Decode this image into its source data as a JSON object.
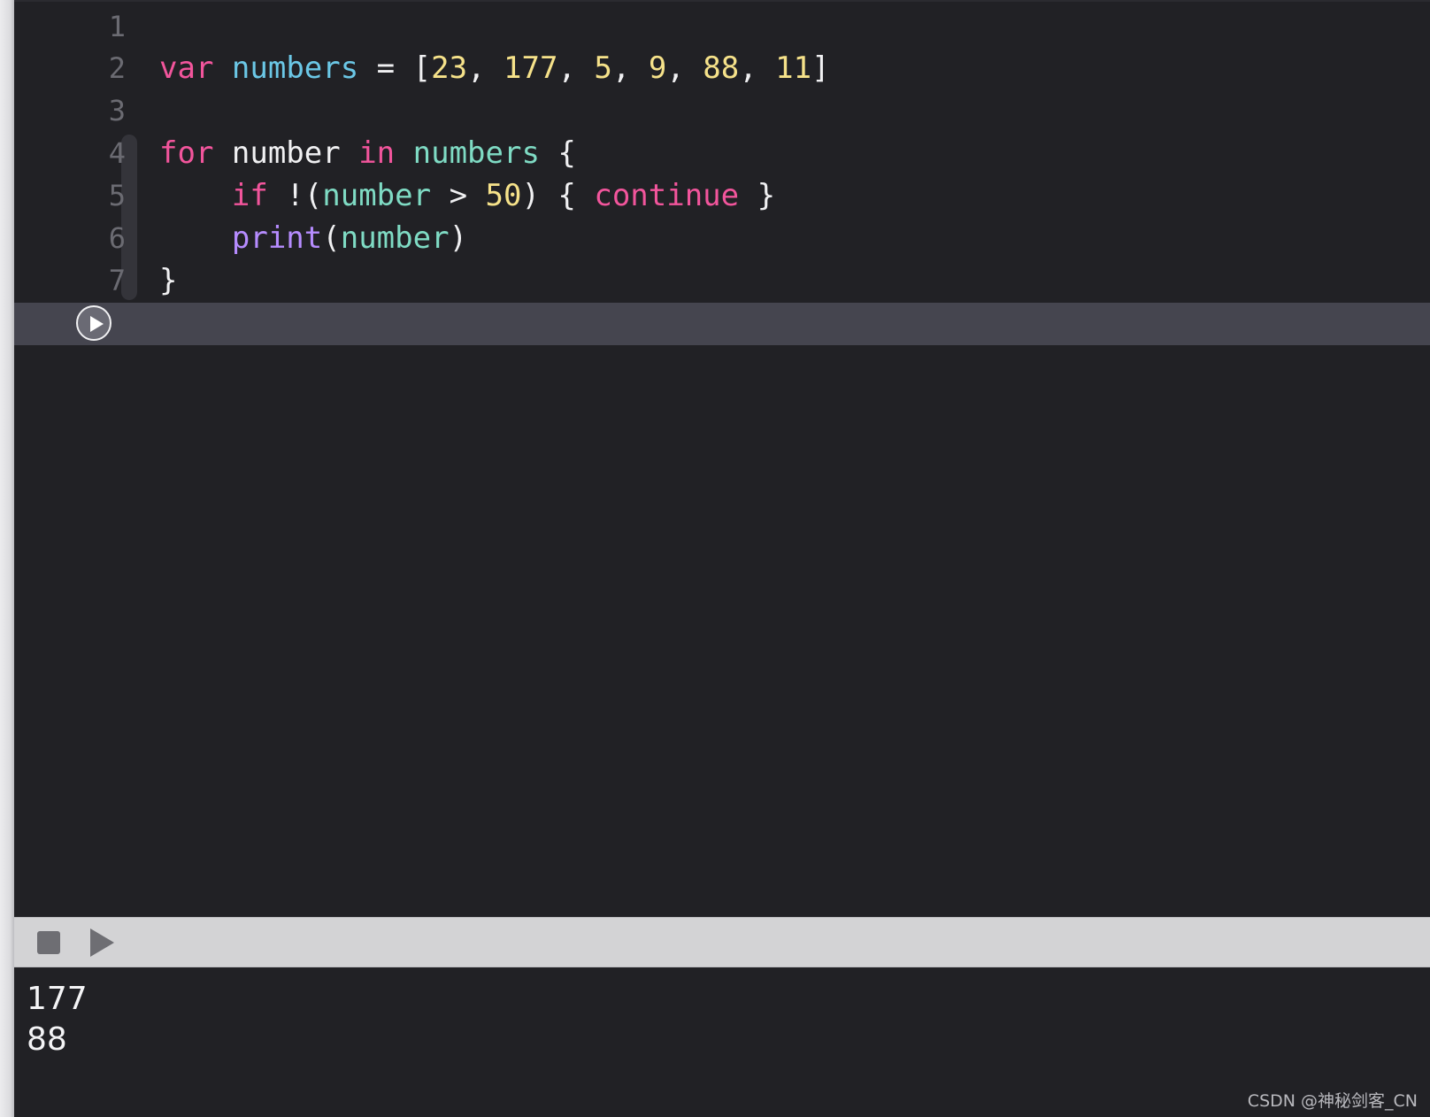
{
  "editor": {
    "lines": [
      {
        "number": "1",
        "tokens": []
      },
      {
        "number": "2",
        "tokens": [
          {
            "text": "var",
            "kind": "keyword"
          },
          {
            "text": " ",
            "kind": "plain"
          },
          {
            "text": "numbers",
            "kind": "identifier"
          },
          {
            "text": " = [",
            "kind": "plain"
          },
          {
            "text": "23",
            "kind": "number"
          },
          {
            "text": ", ",
            "kind": "plain"
          },
          {
            "text": "177",
            "kind": "number"
          },
          {
            "text": ", ",
            "kind": "plain"
          },
          {
            "text": "5",
            "kind": "number"
          },
          {
            "text": ", ",
            "kind": "plain"
          },
          {
            "text": "9",
            "kind": "number"
          },
          {
            "text": ", ",
            "kind": "plain"
          },
          {
            "text": "88",
            "kind": "number"
          },
          {
            "text": ", ",
            "kind": "plain"
          },
          {
            "text": "11",
            "kind": "number"
          },
          {
            "text": "]",
            "kind": "plain"
          }
        ]
      },
      {
        "number": "3",
        "tokens": []
      },
      {
        "number": "4",
        "tokens": [
          {
            "text": "for",
            "kind": "keyword"
          },
          {
            "text": " number ",
            "kind": "plain"
          },
          {
            "text": "in",
            "kind": "keyword"
          },
          {
            "text": " ",
            "kind": "plain"
          },
          {
            "text": "numbers",
            "kind": "variable"
          },
          {
            "text": " {",
            "kind": "plain"
          }
        ]
      },
      {
        "number": "5",
        "tokens": [
          {
            "text": "    ",
            "kind": "plain"
          },
          {
            "text": "if",
            "kind": "keyword"
          },
          {
            "text": " !(",
            "kind": "plain"
          },
          {
            "text": "number",
            "kind": "variable"
          },
          {
            "text": " > ",
            "kind": "plain"
          },
          {
            "text": "50",
            "kind": "number"
          },
          {
            "text": ") { ",
            "kind": "plain"
          },
          {
            "text": "continue",
            "kind": "keyword"
          },
          {
            "text": " }",
            "kind": "plain"
          }
        ]
      },
      {
        "number": "6",
        "tokens": [
          {
            "text": "    ",
            "kind": "plain"
          },
          {
            "text": "print",
            "kind": "function"
          },
          {
            "text": "(",
            "kind": "plain"
          },
          {
            "text": "number",
            "kind": "variable"
          },
          {
            "text": ")",
            "kind": "plain"
          }
        ]
      },
      {
        "number": "7",
        "tokens": [
          {
            "text": "}",
            "kind": "plain"
          }
        ]
      }
    ],
    "run_line_icon": "play-circle-icon"
  },
  "debug_bar": {
    "stop_icon": "stop-icon",
    "run_icon": "play-icon"
  },
  "console": {
    "output_lines": [
      "177",
      "88"
    ]
  },
  "watermark": "CSDN @神秘剑客_CN",
  "colors": {
    "background": "#212125",
    "keyword": "#f2559c",
    "identifier": "#6bc7e6",
    "number": "#f6e28a",
    "function": "#b68cff",
    "variable": "#7fdbc4",
    "plain": "#f0f0f2",
    "line_number": "#6b6b72",
    "current_line": "#45454f"
  }
}
